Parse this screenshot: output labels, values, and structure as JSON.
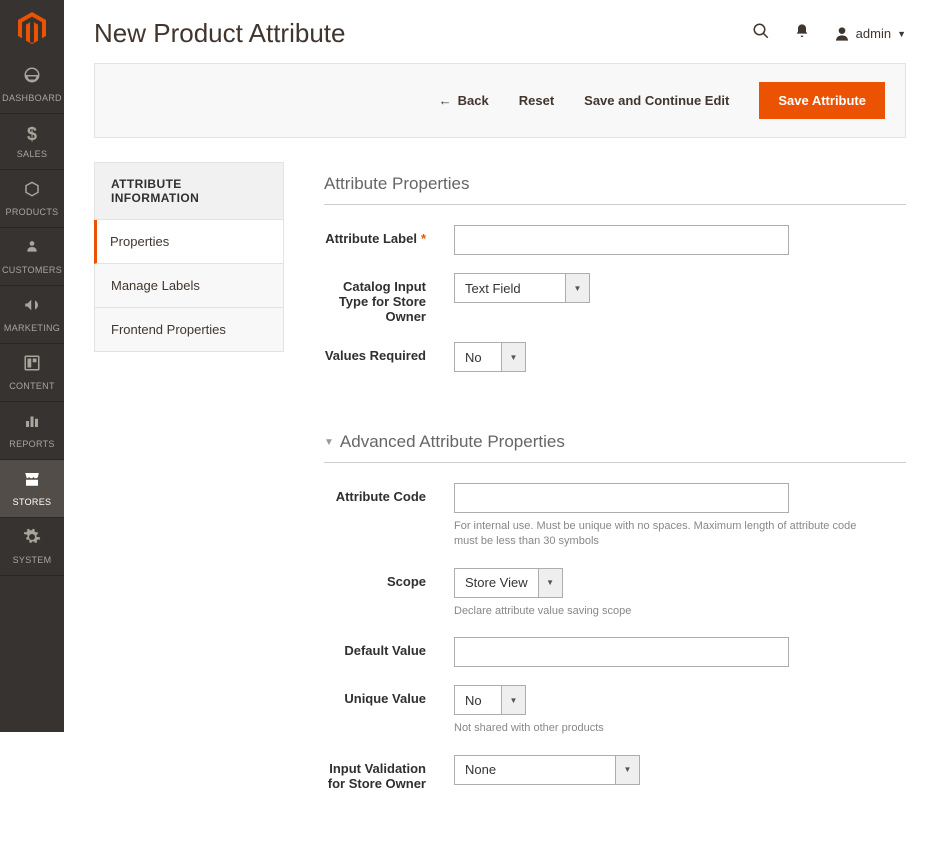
{
  "sidebar": {
    "items": [
      {
        "icon": "◧",
        "label": "DASHBOARD"
      },
      {
        "icon": "$",
        "label": "SALES"
      },
      {
        "icon": "⬢",
        "label": "PRODUCTS"
      },
      {
        "icon": "👤",
        "label": "CUSTOMERS"
      },
      {
        "icon": "📣",
        "label": "MARKETING"
      },
      {
        "icon": "▦",
        "label": "CONTENT"
      },
      {
        "icon": "▮▮",
        "label": "REPORTS"
      },
      {
        "icon": "▥",
        "label": "STORES"
      },
      {
        "icon": "⚙",
        "label": "SYSTEM"
      }
    ]
  },
  "header": {
    "title": "New Product Attribute",
    "user": "admin"
  },
  "toolbar": {
    "back": "Back",
    "reset": "Reset",
    "save_continue": "Save and Continue Edit",
    "save": "Save Attribute"
  },
  "left_panel": {
    "header": "ATTRIBUTE INFORMATION",
    "tabs": [
      {
        "label": "Properties"
      },
      {
        "label": "Manage Labels"
      },
      {
        "label": "Frontend Properties"
      }
    ]
  },
  "sections": {
    "attribute_properties": {
      "title": "Attribute Properties",
      "fields": {
        "attribute_label": {
          "label": "Attribute Label",
          "value": "",
          "required": true
        },
        "catalog_input_type": {
          "label": "Catalog Input Type for Store Owner",
          "value": "Text Field"
        },
        "values_required": {
          "label": "Values Required",
          "value": "No"
        }
      }
    },
    "advanced": {
      "title": "Advanced Attribute Properties",
      "fields": {
        "attribute_code": {
          "label": "Attribute Code",
          "value": "",
          "note": "For internal use. Must be unique with no spaces. Maximum length of attribute code must be less than 30 symbols"
        },
        "scope": {
          "label": "Scope",
          "value": "Store View",
          "note": "Declare attribute value saving scope"
        },
        "default_value": {
          "label": "Default Value",
          "value": ""
        },
        "unique_value": {
          "label": "Unique Value",
          "value": "No",
          "note": "Not shared with other products"
        },
        "input_validation": {
          "label": "Input Validation for Store Owner",
          "value": "None"
        }
      }
    }
  }
}
